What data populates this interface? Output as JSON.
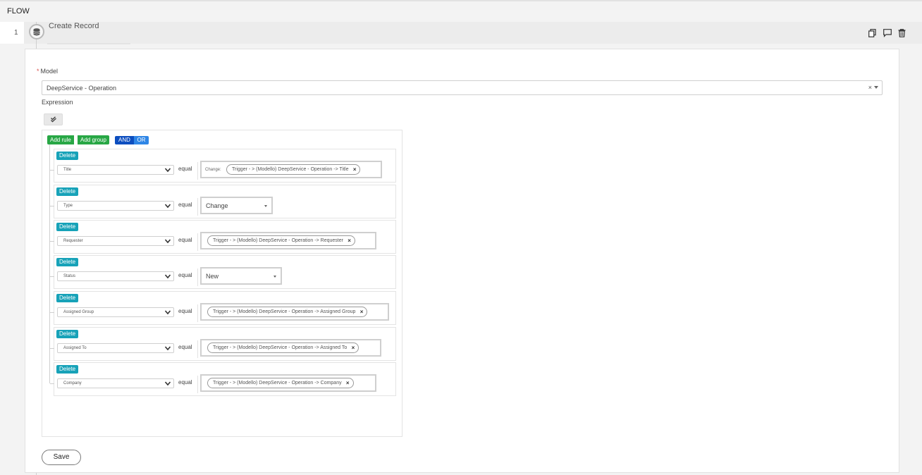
{
  "header": {
    "title": "FLOW"
  },
  "step": {
    "number": "1",
    "title": "Create Record",
    "icon": "database-icon"
  },
  "form": {
    "model_label": "Model",
    "model_required_mark": "*",
    "model_value": "DeepService - Operation",
    "model_clear": "×",
    "expression_label": "Expression"
  },
  "builder": {
    "add_rule": "Add rule",
    "add_group": "Add group",
    "and": "AND",
    "or": "OR",
    "delete_label": "Delete",
    "operator": "equal",
    "rules": [
      {
        "field": "Title",
        "prefix": "Change:",
        "chip": "Trigger - > (Modello) DeepService - Operation -> Title"
      },
      {
        "field": "Type",
        "select": "Change"
      },
      {
        "field": "Requester",
        "chip": "Trigger - > (Modello) DeepService - Operation -> Requester"
      },
      {
        "field": "Status",
        "select": "New"
      },
      {
        "field": "Assigned Group",
        "chip": "Trigger - > (Modello) DeepService - Operation -> Assigned Group"
      },
      {
        "field": "Assigned To",
        "chip": "Trigger - > (Modello) DeepService - Operation -> Assigned To"
      },
      {
        "field": "Company",
        "chip": "Trigger - > (Modello) DeepService - Operation -> Company"
      }
    ]
  },
  "save_label": "Save"
}
